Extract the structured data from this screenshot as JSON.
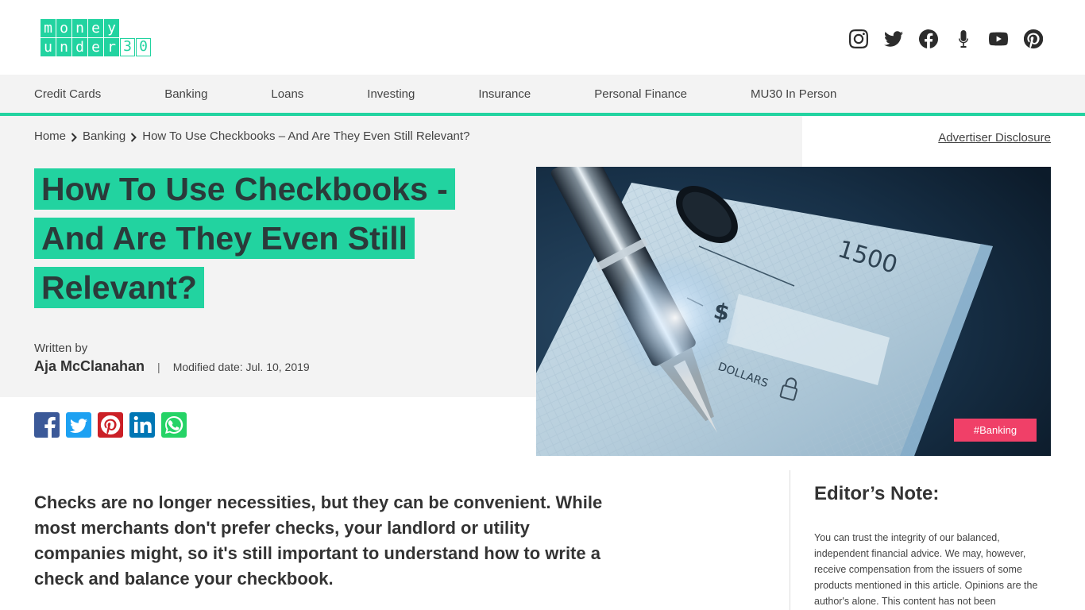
{
  "logo": {
    "row1": [
      "m",
      "o",
      "n",
      "e",
      "y"
    ],
    "row2": [
      "u",
      "n",
      "d",
      "e",
      "r"
    ],
    "row2_outline": [
      "3",
      "0"
    ]
  },
  "social_icons": [
    "instagram-icon",
    "twitter-icon",
    "facebook-icon",
    "microphone-icon",
    "youtube-icon",
    "pinterest-icon"
  ],
  "nav": {
    "items": [
      "Credit Cards",
      "Banking",
      "Loans",
      "Investing",
      "Insurance",
      "Personal Finance",
      "MU30 In Person"
    ]
  },
  "breadcrumb": {
    "home": "Home",
    "category": "Banking",
    "current": "How To Use Checkbooks – And Are They Even Still Relevant?"
  },
  "disclosure": "Advertiser Disclosure",
  "article": {
    "title_lines": [
      "How To Use Checkbooks -",
      "And Are They Even Still",
      "Relevant?"
    ],
    "written_by": "Written by",
    "author": "Aja McClanahan",
    "separator": "|",
    "modified": "Modified date: Jul. 10, 2019",
    "tag": "#Banking",
    "lead": "Checks are no longer necessities, but they can be convenient. While most merchants don't prefer checks, your landlord or utility companies might, so it's still important to understand how to write a check and balance your checkbook."
  },
  "hero_image": {
    "check_amount": "1500",
    "currency_symbol": "$",
    "dollars_label": "DOLLARS"
  },
  "share_icons": [
    "facebook-share-icon",
    "twitter-share-icon",
    "pinterest-share-icon",
    "linkedin-share-icon",
    "whatsapp-share-icon"
  ],
  "editor_note": {
    "title": "Editor’s Note:",
    "body": "You can trust the integrity of our balanced, independent financial advice. We may, however, receive compensation from the issuers of some products mentioned in this article. Opinions are the author's alone. This content has not been"
  },
  "colors": {
    "accent": "#22d3a0",
    "tag": "#f04068",
    "facebook": "#3b5998",
    "twitter": "#1da1f2",
    "pinterest": "#cb2027",
    "linkedin": "#0077b5",
    "whatsapp": "#25d366"
  }
}
